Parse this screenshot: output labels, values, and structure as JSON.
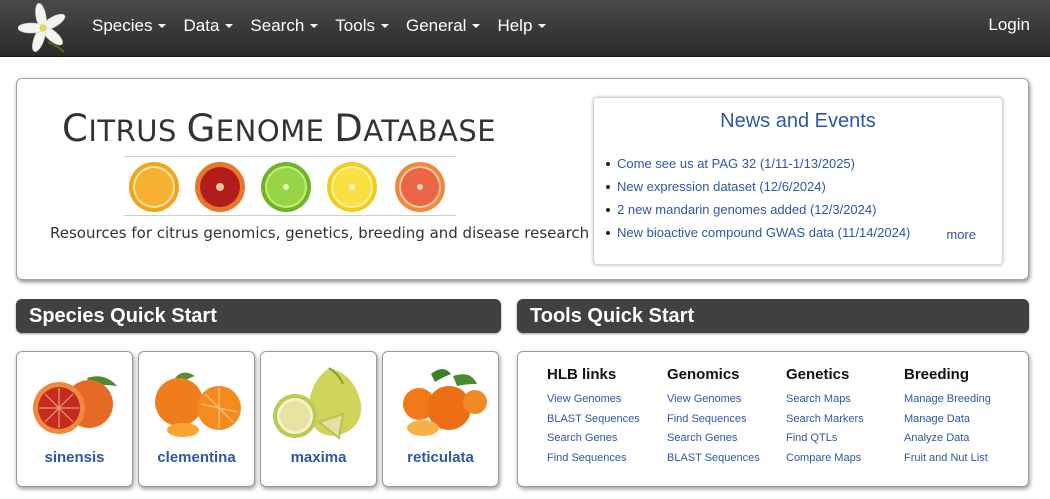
{
  "nav": {
    "items": [
      "Species",
      "Data",
      "Search",
      "Tools",
      "General",
      "Help"
    ],
    "login": "Login"
  },
  "hero": {
    "title_parts": [
      "C",
      "ITRUS ",
      "G",
      "ENOME ",
      "D",
      "ATABASE"
    ],
    "tagline": "Resources for citrus genomics, genetics, breeding and disease research"
  },
  "news": {
    "title": "News and Events",
    "items": [
      "Come see us at PAG 32 (1/11-1/13/2025)",
      "New expression dataset (12/6/2024)",
      "2 new mandarin genomes added (12/3/2024)",
      "New bioactive compound GWAS data (11/14/2024)"
    ],
    "more": "more"
  },
  "species_quick_start": {
    "header": "Species Quick Start",
    "cards": [
      "sinensis",
      "clementina",
      "maxima",
      "reticulata"
    ]
  },
  "tools_quick_start": {
    "header": "Tools Quick Start",
    "columns": [
      {
        "title": "HLB links",
        "links": [
          "View Genomes",
          "BLAST Sequences",
          "Search Genes",
          "Find Sequences"
        ]
      },
      {
        "title": "Genomics",
        "links": [
          "View Genomes",
          "Find Sequences",
          "Search Genes",
          "BLAST Sequences"
        ]
      },
      {
        "title": "Genetics",
        "links": [
          "Search Maps",
          "Search Markers",
          "Find QTLs",
          "Compare Maps"
        ]
      },
      {
        "title": "Breeding",
        "links": [
          "Manage Breeding",
          "Manage Data",
          "Analyze Data",
          "Fruit and Nut List"
        ]
      }
    ]
  },
  "colors": {
    "navbar": "#333333",
    "link": "#2e58a0",
    "section_header": "#414141"
  },
  "icons": {
    "logo": "citrus-flower-logo-icon",
    "caret": "caret-down-icon"
  }
}
